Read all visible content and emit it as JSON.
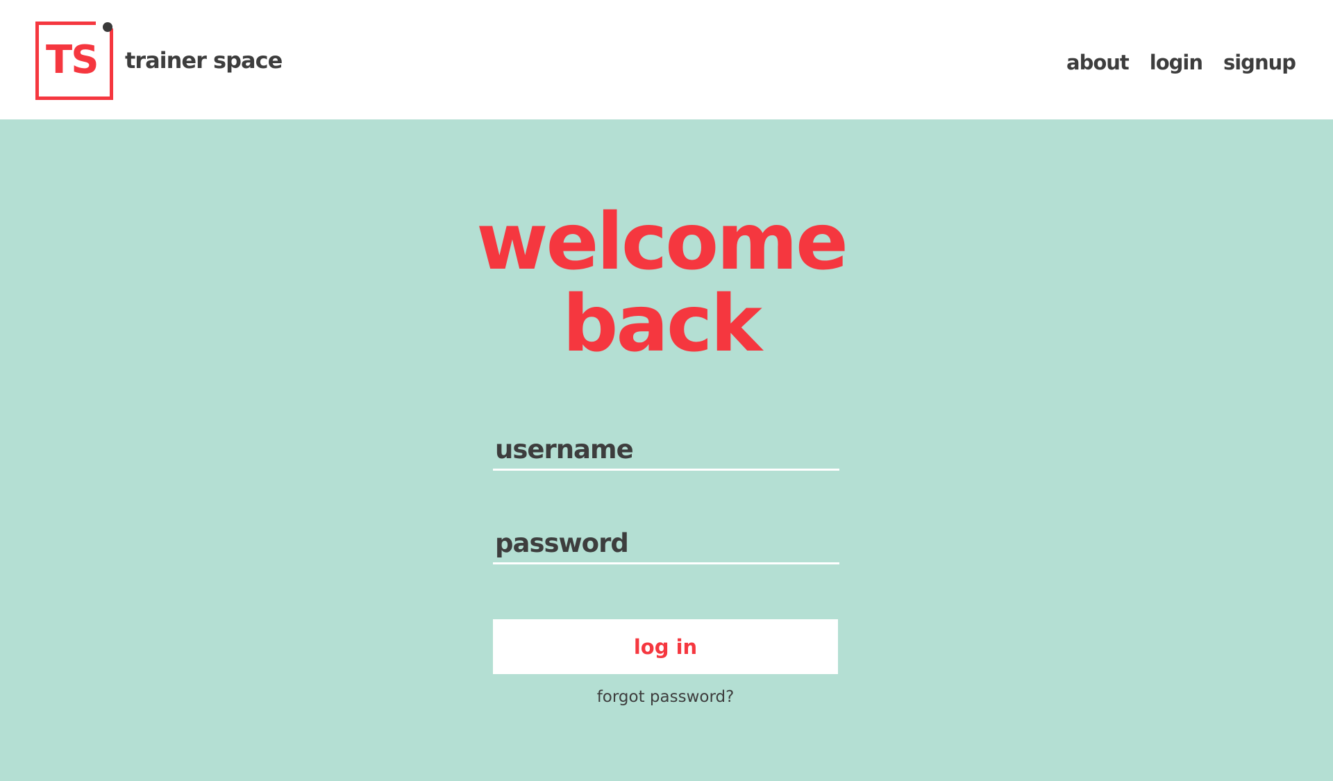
{
  "header": {
    "logo": {
      "letters": "TS",
      "icon": "trainer-space-logo"
    },
    "brand_name": "trainer space",
    "nav": [
      {
        "label": "about"
      },
      {
        "label": "login"
      },
      {
        "label": "signup"
      }
    ]
  },
  "main": {
    "headline_line1": "welcome",
    "headline_line2": "back",
    "username": {
      "value": "",
      "placeholder": "username"
    },
    "password": {
      "value": "",
      "placeholder": "password"
    },
    "login_button_label": "log in",
    "forgot_password_label": "forgot password?"
  },
  "colors": {
    "accent": "#f5373f",
    "background": "#b4dfd3",
    "text": "#3d3d3d",
    "header_background": "#ffffff"
  }
}
